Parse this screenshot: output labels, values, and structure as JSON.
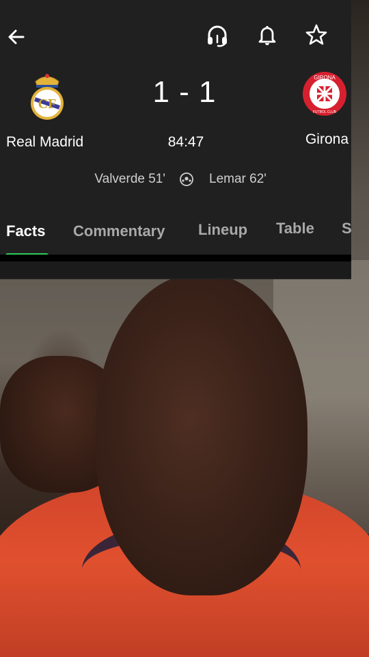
{
  "match": {
    "score": "1 - 1",
    "clock": "84:47",
    "home": {
      "name": "Real Madrid",
      "scorer": "Valverde 51'"
    },
    "away": {
      "name": "Girona",
      "scorer": "Lemar 62'",
      "crest_text": "GIRONA",
      "crest_subtext": "FUTBOL CLUB"
    }
  },
  "toolbar": {
    "icons": [
      "back-icon",
      "headphones-icon",
      "bell-icon",
      "star-icon"
    ]
  },
  "tabs": [
    {
      "label": "Facts",
      "active": true
    },
    {
      "label": "Commentary",
      "active": false
    },
    {
      "label": "Lineup",
      "active": false
    },
    {
      "label": "Table",
      "active": false
    },
    {
      "label": "S",
      "active": false
    }
  ],
  "colors": {
    "panel": "#202020",
    "accent": "#2ecc5b",
    "girona_red": "#d7202f"
  }
}
